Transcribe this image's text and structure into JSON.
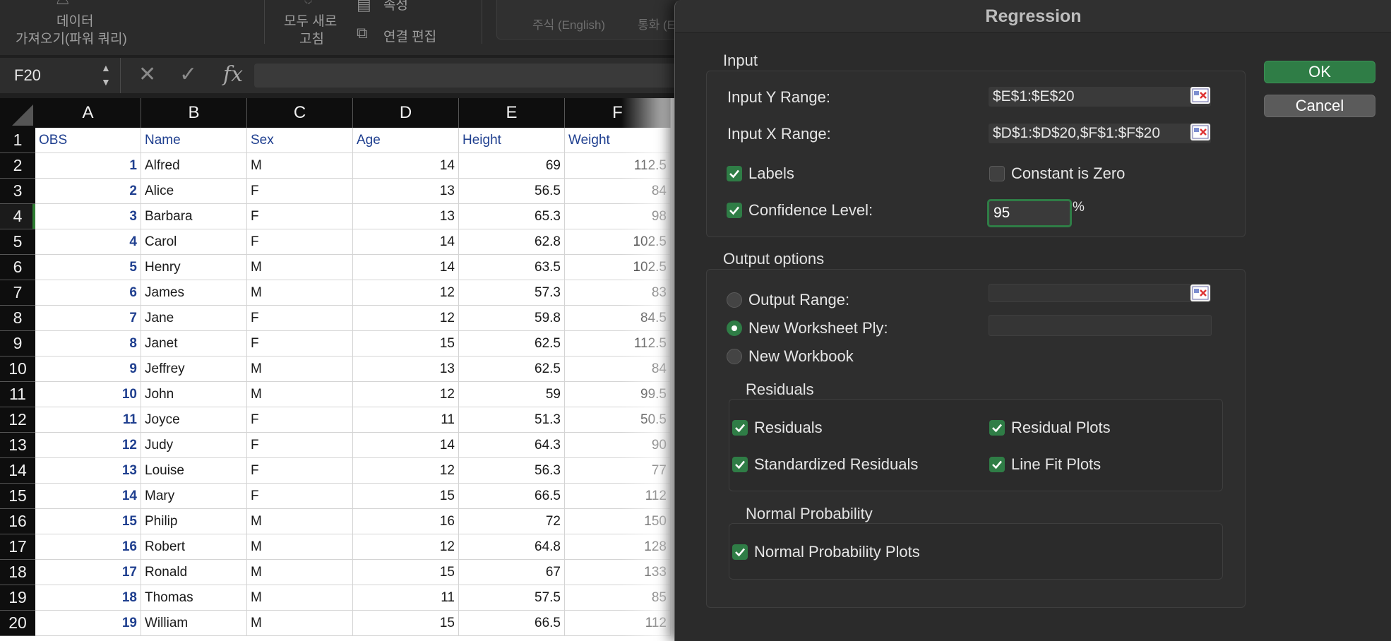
{
  "ribbon": {
    "get_data_line1": "데이터",
    "get_data_line2": "가져오기(파워 쿼리)",
    "refresh_line1": "모두 새로",
    "refresh_line2": "고침",
    "properties": "속성",
    "edit_links": "연결 편집",
    "stocks": "주식 (English)",
    "currencies": "통화 (E"
  },
  "formula_bar": {
    "cell_ref": "F20",
    "cancel_icon": "✕",
    "enter_icon": "✓",
    "fx": "fx",
    "content": ""
  },
  "sheet": {
    "columns": [
      "A",
      "B",
      "C",
      "D",
      "E",
      "F"
    ],
    "rows": [
      "1",
      "2",
      "3",
      "4",
      "5",
      "6",
      "7",
      "8",
      "9",
      "10",
      "11",
      "12",
      "13",
      "14",
      "15",
      "16",
      "17",
      "18",
      "19",
      "20"
    ],
    "selected_row": "4",
    "header": [
      "OBS",
      "Name",
      "Sex",
      "Age",
      "Height",
      "Weight"
    ],
    "data": [
      [
        "1",
        "Alfred",
        "M",
        "14",
        "69",
        "112.5"
      ],
      [
        "2",
        "Alice",
        "F",
        "13",
        "56.5",
        "84"
      ],
      [
        "3",
        "Barbara",
        "F",
        "13",
        "65.3",
        "98"
      ],
      [
        "4",
        "Carol",
        "F",
        "14",
        "62.8",
        "102.5"
      ],
      [
        "5",
        "Henry",
        "M",
        "14",
        "63.5",
        "102.5"
      ],
      [
        "6",
        "James",
        "M",
        "12",
        "57.3",
        "83"
      ],
      [
        "7",
        "Jane",
        "F",
        "12",
        "59.8",
        "84.5"
      ],
      [
        "8",
        "Janet",
        "F",
        "15",
        "62.5",
        "112.5"
      ],
      [
        "9",
        "Jeffrey",
        "M",
        "13",
        "62.5",
        "84"
      ],
      [
        "10",
        "John",
        "M",
        "12",
        "59",
        "99.5"
      ],
      [
        "11",
        "Joyce",
        "F",
        "11",
        "51.3",
        "50.5"
      ],
      [
        "12",
        "Judy",
        "F",
        "14",
        "64.3",
        "90"
      ],
      [
        "13",
        "Louise",
        "F",
        "12",
        "56.3",
        "77"
      ],
      [
        "14",
        "Mary",
        "F",
        "15",
        "66.5",
        "112"
      ],
      [
        "15",
        "Philip",
        "M",
        "16",
        "72",
        "150"
      ],
      [
        "16",
        "Robert",
        "M",
        "12",
        "64.8",
        "128"
      ],
      [
        "17",
        "Ronald",
        "M",
        "15",
        "67",
        "133"
      ],
      [
        "18",
        "Thomas",
        "M",
        "11",
        "57.5",
        "85"
      ],
      [
        "19",
        "William",
        "M",
        "15",
        "66.5",
        "112"
      ]
    ]
  },
  "dialog": {
    "title": "Regression",
    "input_section": "Input",
    "input_y_label": "Input Y Range:",
    "input_y_value": "$E$1:$E$20",
    "input_x_label": "Input X Range:",
    "input_x_value": "$D$1:$D$20,$F$1:$F$20",
    "labels": "Labels",
    "constant_zero": "Constant is Zero",
    "confidence_level": "Confidence Level:",
    "confidence_value": "95",
    "percent": "%",
    "output_section": "Output options",
    "output_range": "Output Range:",
    "new_worksheet": "New Worksheet Ply:",
    "new_workbook": "New Workbook",
    "residuals_section": "Residuals",
    "residuals": "Residuals",
    "residual_plots": "Residual Plots",
    "standardized_residuals": "Standardized Residuals",
    "line_fit_plots": "Line Fit Plots",
    "normal_section": "Normal Probability",
    "normal_plots": "Normal Probability Plots",
    "ok": "OK",
    "cancel": "Cancel"
  },
  "colors": {
    "accent_green": "#2f7d46",
    "header_blue": "#1f3f8f"
  }
}
